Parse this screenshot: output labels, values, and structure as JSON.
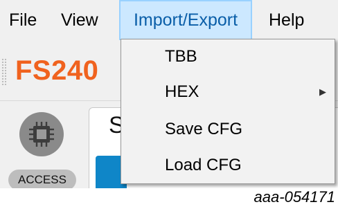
{
  "menubar": {
    "file": "File",
    "view": "View",
    "import_export": "Import/Export",
    "help": "Help"
  },
  "brand": {
    "text": "FS240"
  },
  "toolbar": {
    "access_label": "ACCESS",
    "icon": "chip-icon"
  },
  "panel": {
    "partial_text": "S"
  },
  "dropdown": {
    "items": [
      {
        "label": "TBB",
        "has_submenu": false
      },
      {
        "label": "HEX",
        "has_submenu": true
      },
      {
        "label": "Save CFG",
        "has_submenu": false
      },
      {
        "label": "Load CFG",
        "has_submenu": false
      }
    ]
  },
  "caption": "aaa-054171",
  "colors": {
    "menu_highlight": "#cce8ff",
    "brand_orange": "#f0621e",
    "tab_blue": "#0f86c8"
  }
}
